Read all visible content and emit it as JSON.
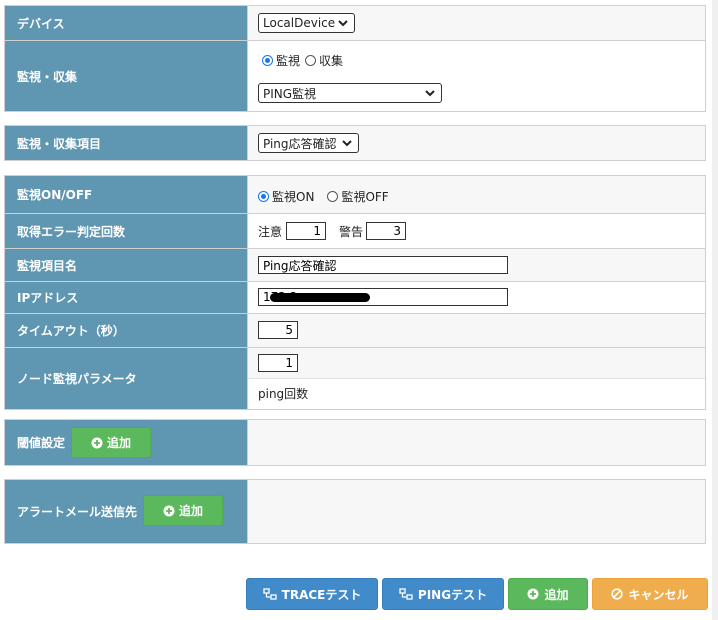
{
  "device": {
    "label": "デバイス",
    "selected": "LocalDevice"
  },
  "monitor_collect": {
    "label": "監視・収集",
    "radio_monitor": "監視",
    "radio_collect": "収集",
    "method_selected": "PING監視"
  },
  "monitor_item": {
    "label": "監視・収集項目",
    "selected": "Ping応答確認"
  },
  "monitor_onoff": {
    "label": "監視ON/OFF",
    "on_label": "監視ON",
    "off_label": "監視OFF"
  },
  "error_count": {
    "label": "取得エラー判定回数",
    "caution_label": "注意",
    "caution_value": "1",
    "warning_label": "警告",
    "warning_value": "3"
  },
  "item_name": {
    "label": "監視項目名",
    "value": "Ping応答確認"
  },
  "ip_address": {
    "label": "IPアドレス",
    "value": "172.2"
  },
  "timeout": {
    "label": "タイムアウト（秒）",
    "value": "5"
  },
  "node_param": {
    "label": "ノード監視パラメータ",
    "value": "1",
    "unit": "ping回数"
  },
  "threshold": {
    "label": "閾値設定",
    "add_label": "追加"
  },
  "alert_mail": {
    "label": "アラートメール送信先",
    "add_label": "追加"
  },
  "footer": {
    "trace_test": "TRACEテスト",
    "ping_test": "PINGテスト",
    "add": "追加",
    "cancel": "キャンセル"
  },
  "colors": {
    "label_bg": "#5f96b2",
    "primary": "#428bca",
    "success": "#5cb85c",
    "warning": "#f0ad4e"
  }
}
